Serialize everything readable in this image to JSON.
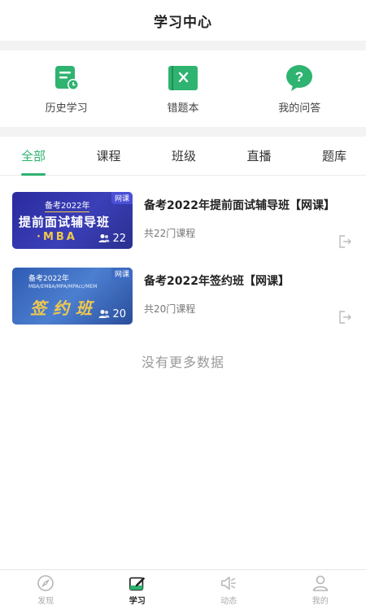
{
  "header": {
    "title": "学习中心"
  },
  "quick_actions": [
    {
      "label": "历史学习",
      "icon": "history-doc-icon"
    },
    {
      "label": "错题本",
      "icon": "wrong-book-icon"
    },
    {
      "label": "我的问答",
      "icon": "question-bubble-icon"
    }
  ],
  "tabs": [
    {
      "label": "全部",
      "active": true
    },
    {
      "label": "课程",
      "active": false
    },
    {
      "label": "班级",
      "active": false
    },
    {
      "label": "直播",
      "active": false
    },
    {
      "label": "题库",
      "active": false
    }
  ],
  "courses": [
    {
      "title": "备考2022年提前面试辅导班【网课】",
      "meta": "共22门课程",
      "thumb": {
        "badge": "网课",
        "top": "备考2022年",
        "main": "提前面试辅导班",
        "sub": "·MBA",
        "count": "22"
      }
    },
    {
      "title": "备考2022年签约班【网课】",
      "meta": "共20门课程",
      "thumb": {
        "badge": "网课",
        "top": "备考2022年",
        "small": "MBA/EMBA/MPA/MPAcc/MEM",
        "main": "签约班",
        "count": "20"
      }
    }
  ],
  "no_more_text": "没有更多数据",
  "tabbar": [
    {
      "label": "发现",
      "icon": "compass-icon",
      "active": false
    },
    {
      "label": "学习",
      "icon": "study-icon",
      "active": true
    },
    {
      "label": "动态",
      "icon": "speaker-icon",
      "active": false
    },
    {
      "label": "我的",
      "icon": "user-icon",
      "active": false
    }
  ],
  "colors": {
    "accent": "#2fb370",
    "muted": "#999999"
  }
}
